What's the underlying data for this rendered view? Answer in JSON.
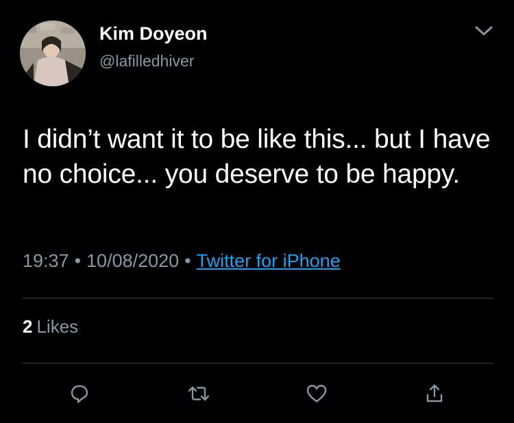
{
  "user": {
    "display_name": "Kim Doyeon",
    "handle": "@lafilledhiver"
  },
  "tweet": {
    "text": "I didn’t want it to be like this... but I have no choice... you deserve to be happy.",
    "time": "19:37",
    "date": "10/08/2020",
    "separator": "•",
    "source": "Twitter for iPhone"
  },
  "stats": {
    "likes_count": "2",
    "likes_label": "Likes"
  },
  "icons": {
    "menu": "chevron-down-icon",
    "reply": "reply-icon",
    "retweet": "retweet-icon",
    "like": "heart-icon",
    "share": "share-icon"
  },
  "colors": {
    "background": "#000000",
    "text": "#ffffff",
    "secondary_text": "#8899a6",
    "link": "#1da1f2",
    "divider": "#3a3f44"
  }
}
